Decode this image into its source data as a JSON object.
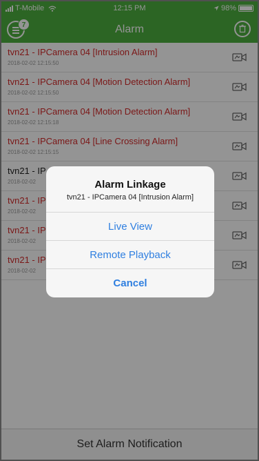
{
  "status_bar": {
    "carrier": "T-Mobile",
    "time": "12:15 PM",
    "battery": "98%"
  },
  "nav": {
    "title": "Alarm",
    "badge_count": "7"
  },
  "alarms": [
    {
      "title": "tvn21 - IPCamera 04 [Intrusion Alarm]",
      "time": "2018-02-02 12:15:50"
    },
    {
      "title": "tvn21 - IPCamera 04 [Motion Detection Alarm]",
      "time": "2018-02-02 12:15:50"
    },
    {
      "title": "tvn21 - IPCamera 04 [Motion Detection Alarm]",
      "time": "2018-02-02 12:15:18"
    },
    {
      "title": "tvn21 - IPCamera 04 [Line Crossing Alarm]",
      "time": "2018-02-02 12:15:15"
    },
    {
      "title": "tvn21 - IP",
      "time": "2018-02-02"
    },
    {
      "title": "tvn21 - IP",
      "time": "2018-02-02"
    },
    {
      "title": "tvn21 - IP",
      "time": "2018-02-02"
    },
    {
      "title": "tvn21 - IP",
      "time": "2018-02-02"
    }
  ],
  "footer": {
    "label": "Set Alarm Notification"
  },
  "dialog": {
    "title": "Alarm Linkage",
    "subtitle": "tvn21 - IPCamera 04 [Intrusion Alarm]",
    "buttons": [
      "Live View",
      "Remote Playback",
      "Cancel"
    ]
  },
  "colors": {
    "brand_green": "#4caf3f",
    "alarm_red": "#d42a2a",
    "action_blue": "#2f7fe0"
  },
  "icons": [
    "signal-icon",
    "wifi-icon",
    "location-icon",
    "battery-icon",
    "menu-icon",
    "trash-icon",
    "camera-playback-icon"
  ]
}
